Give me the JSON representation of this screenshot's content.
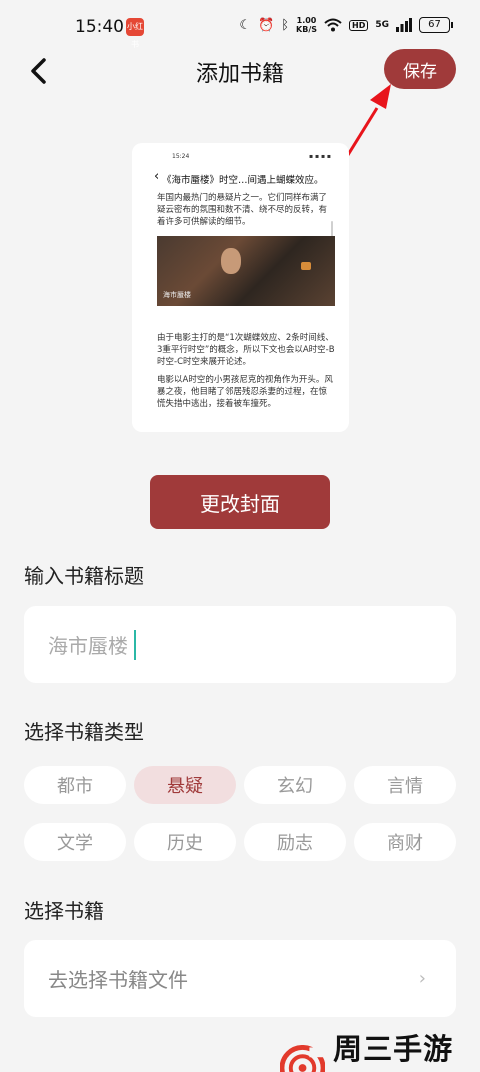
{
  "status_bar": {
    "time": "15:40",
    "app_badge": "小红书",
    "net_speed_value": "1.00",
    "net_speed_unit": "KB/S",
    "hd": "HD",
    "network": "5G",
    "battery": "67"
  },
  "header": {
    "title": "添加书籍",
    "save_label": "保存"
  },
  "cover": {
    "status_time": "15:24",
    "headline": "《海市蜃楼》时空…间遇上蝴蝶效应。",
    "paragraph_1": "年国内最热门的悬疑片之一。它们同样布满了疑云密布的氛围和数不清、绕不尽的反转，有着许多可供解读的细节。",
    "image_label": "海市蜃楼",
    "paragraph_2": "由于电影主打的是“1次蝴蝶效应、2条时间线、3重平行时空”的概念，所以下文也会以A时空-B时空-C时空来展开论述。",
    "paragraph_3": "电影以A时空的小男孩尼克的视角作为开头。风暴之夜，他目睹了邻居残忍杀妻的过程，在惊慌失措中逃出，接着被车撞死。"
  },
  "change_cover_label": "更改封面",
  "title_section": {
    "label": "输入书籍标题",
    "input_value": "海市蜃楼"
  },
  "type_section": {
    "label": "选择书籍类型",
    "chips": [
      "都市",
      "悬疑",
      "玄幻",
      "言情",
      "文学",
      "历史",
      "励志",
      "商财"
    ],
    "selected": "悬疑"
  },
  "file_section": {
    "label": "选择书籍",
    "placeholder": "去选择书籍文件"
  },
  "watermark": {
    "text": "周三手游网"
  },
  "colors": {
    "accent": "#a03a3a",
    "selected_chip_bg": "#f2dedf",
    "annotation_arrow": "#e8141b"
  }
}
